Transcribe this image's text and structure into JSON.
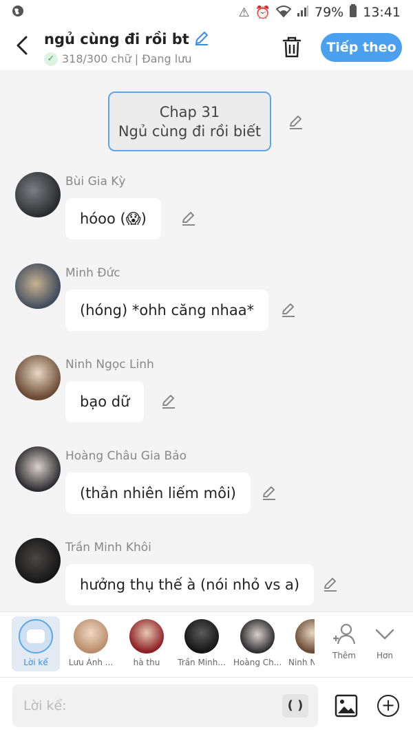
{
  "status_bar": {
    "battery": "79%",
    "time": "13:41"
  },
  "header": {
    "title": "ngủ cùng đi rồi bt",
    "subtitle": "318/300 chữ | Đang lưu",
    "next_label": "Tiếp theo"
  },
  "chapter": {
    "line1": "Chap 31",
    "line2": "Ngủ cùng đi rồi biết"
  },
  "messages": [
    {
      "author": "Bùi Gia Kỳ",
      "text": "hóoo (😱)"
    },
    {
      "author": "Minh Đức",
      "text": "(hóng) *ohh căng nhaa*"
    },
    {
      "author": "Ninh Ngọc Linh",
      "text": "bạo dữ"
    },
    {
      "author": "Hoàng Châu Gia Bảo",
      "text": "(thản nhiên liếm môi)"
    },
    {
      "author": "Trần Minh Khôi",
      "text": "hưởng thụ thế à (nói nhỏ vs a)"
    }
  ],
  "characters": [
    {
      "name": "Lời kể"
    },
    {
      "name": "Lưu Ánh ..."
    },
    {
      "name": "hà thu"
    },
    {
      "name": "Trần Minh..."
    },
    {
      "name": "Hoàng Ch..."
    },
    {
      "name": "Ninh N"
    }
  ],
  "add_label": "Thêm",
  "more_label": "Hơn",
  "input": {
    "placeholder": "Lời kể:",
    "paren_label": "( )"
  },
  "colors": {
    "accent": "#4aa0ef",
    "background": "#f4f4f4"
  }
}
